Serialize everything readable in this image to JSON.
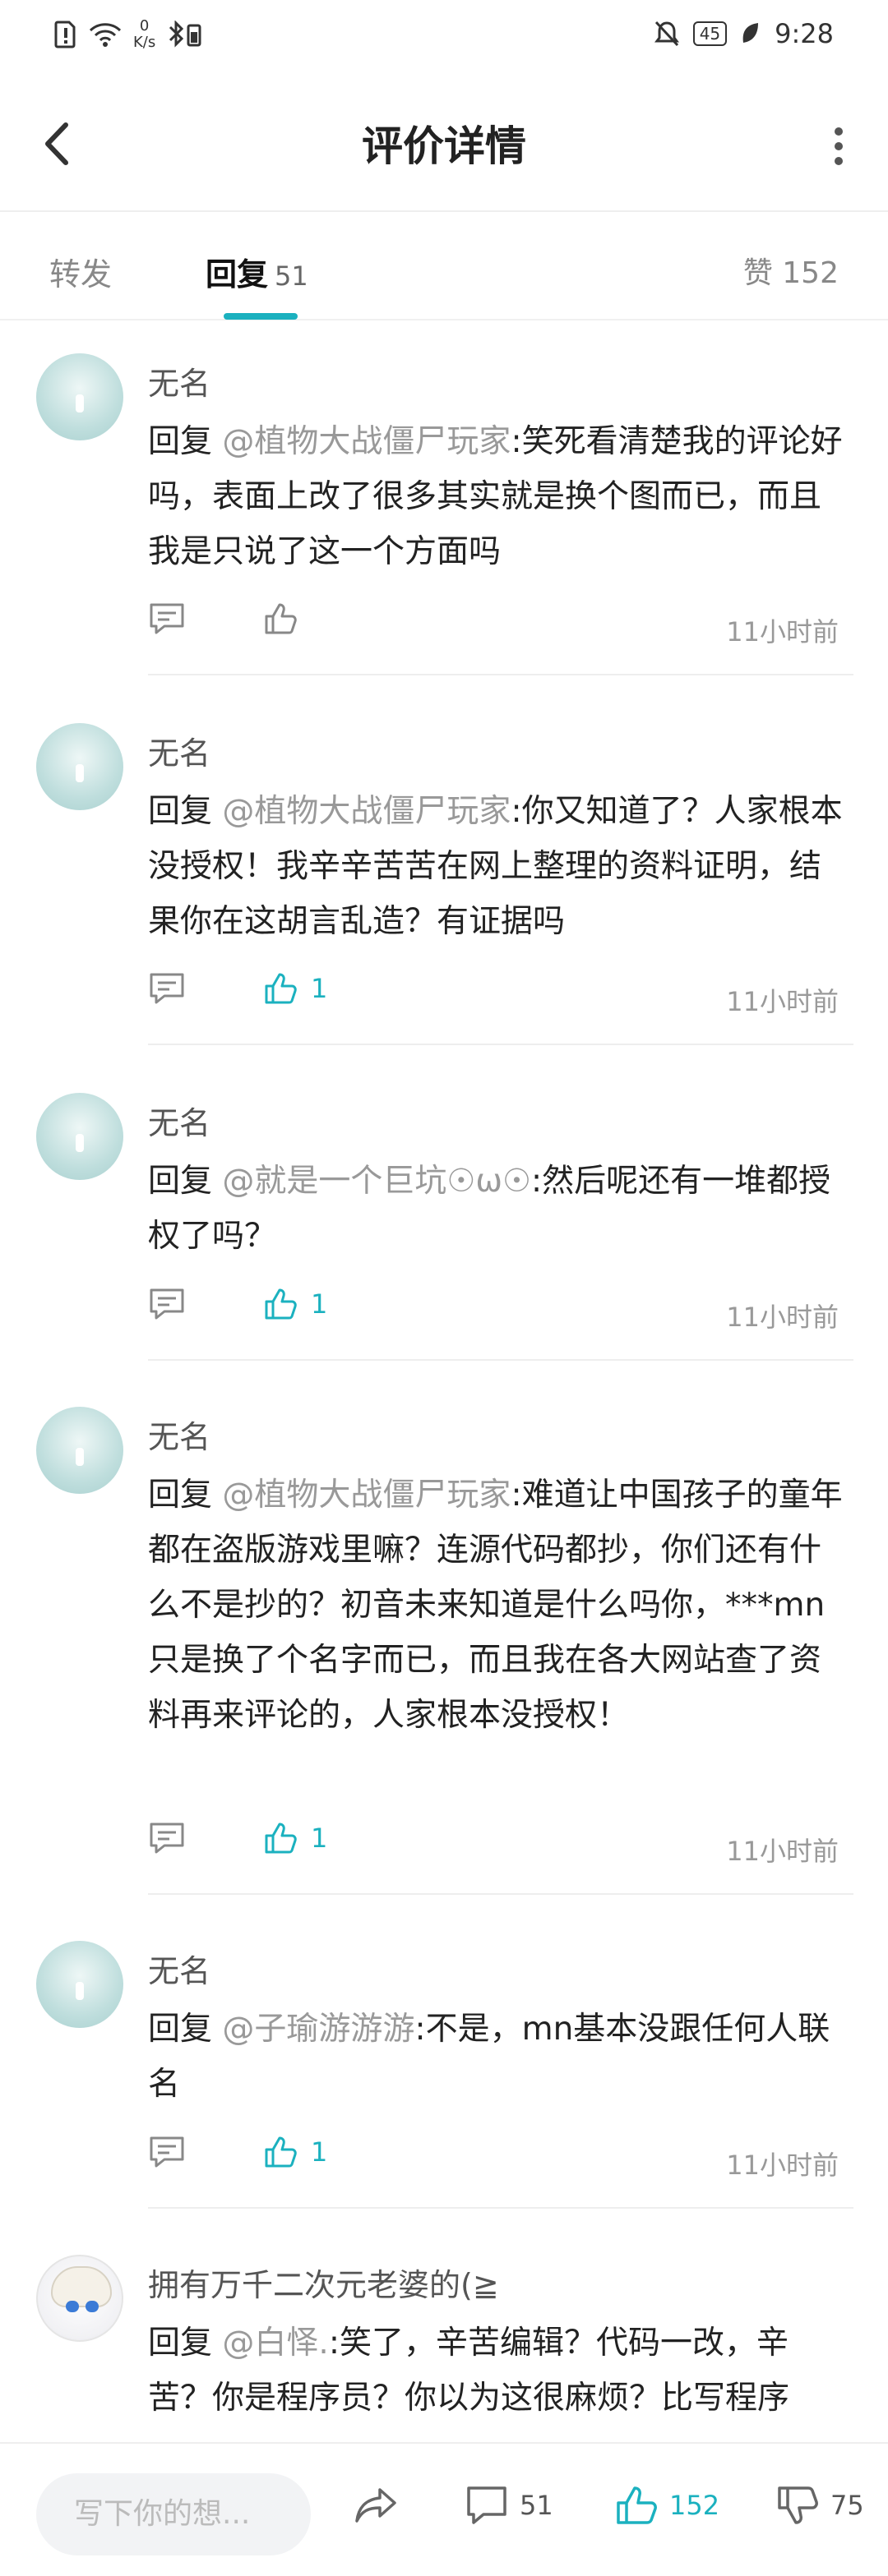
{
  "status_bar": {
    "net_speed_value": "0",
    "net_speed_unit": "K/s",
    "battery": "45",
    "time": "9:28"
  },
  "header": {
    "title": "评价详情"
  },
  "tabs": {
    "forward": "转发",
    "reply": "回复",
    "reply_count": "51",
    "like": "赞",
    "like_count": "152"
  },
  "comments": [
    {
      "user": "无名",
      "prefix": "回复",
      "mention": "@植物大战僵尸玩家",
      "text": ":笑死看清楚我的评论好吗，表面上改了很多其实就是换个图而已，而且我是只说了这一个方面吗",
      "likes": "",
      "time": "11小时前"
    },
    {
      "user": "无名",
      "prefix": "回复",
      "mention": "@植物大战僵尸玩家",
      "text": ":你又知道了？人家根本没授权！我辛辛苦苦在网上整理的资料证明，结果你在这胡言乱造？有证据吗",
      "likes": "1",
      "time": "11小时前"
    },
    {
      "user": "无名",
      "prefix": "回复",
      "mention": "@就是一个巨坑☉ω☉",
      "text": ":然后呢还有一堆都授权了吗？",
      "likes": "1",
      "time": "11小时前"
    },
    {
      "user": "无名",
      "prefix": "回复",
      "mention": "@植物大战僵尸玩家",
      "text": ":难道让中国孩子的童年都在盗版游戏里嘛？连源代码都抄，你们还有什么不是抄的？初音未来知道是什么吗你，***mn只是换了个名字而已，而且我在各大网站查了资料再来评论的，人家根本没授权！",
      "likes": "1",
      "time": "11小时前"
    },
    {
      "user": "无名",
      "prefix": "回复",
      "mention": "@子瑜游游游",
      "text": ":不是，mn基本没跟任何人联名",
      "likes": "1",
      "time": "11小时前"
    },
    {
      "user": "拥有万千二次元老婆的(≧",
      "prefix": "回复",
      "mention": "@白怿.",
      "text": ":笑了，辛苦编辑？代码一改，辛苦？你是程序员？你以为这很麻烦？比写程序",
      "likes": "",
      "time": ""
    }
  ],
  "bottom_bar": {
    "placeholder": "写下你的想...",
    "comment_count": "51",
    "like_count": "152",
    "dislike_count": "75"
  },
  "colors": {
    "accent": "#1bb1bf",
    "muted": "#999999"
  }
}
